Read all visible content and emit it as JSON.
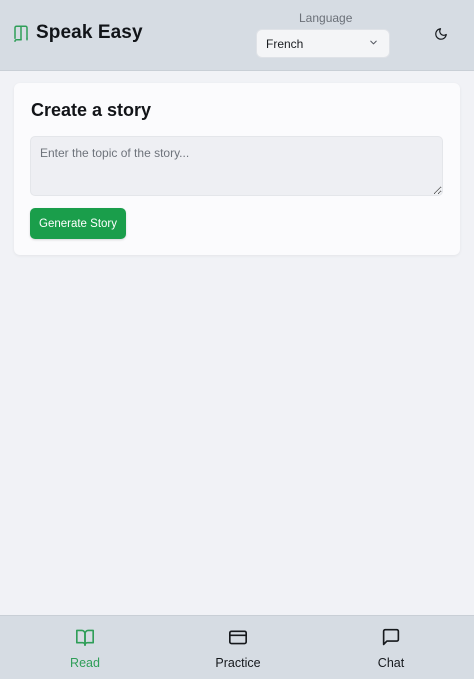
{
  "header": {
    "title": "Speak Easy",
    "brand_icon": "book-open-icon",
    "language_label": "Language",
    "language_value": "French",
    "theme_icon": "moon-icon"
  },
  "story": {
    "title": "Create a story",
    "topic_placeholder": "Enter the topic of the story...",
    "topic_value": "",
    "generate_label": "Generate Story"
  },
  "nav": {
    "items": [
      {
        "label": "Read",
        "icon": "book-icon",
        "active": true
      },
      {
        "label": "Practice",
        "icon": "card-icon",
        "active": false
      },
      {
        "label": "Chat",
        "icon": "chat-bubble-icon",
        "active": false
      }
    ]
  },
  "colors": {
    "accent": "#1a9e4b",
    "active_nav": "#2f9e58",
    "header_bg": "#d6dce3"
  }
}
